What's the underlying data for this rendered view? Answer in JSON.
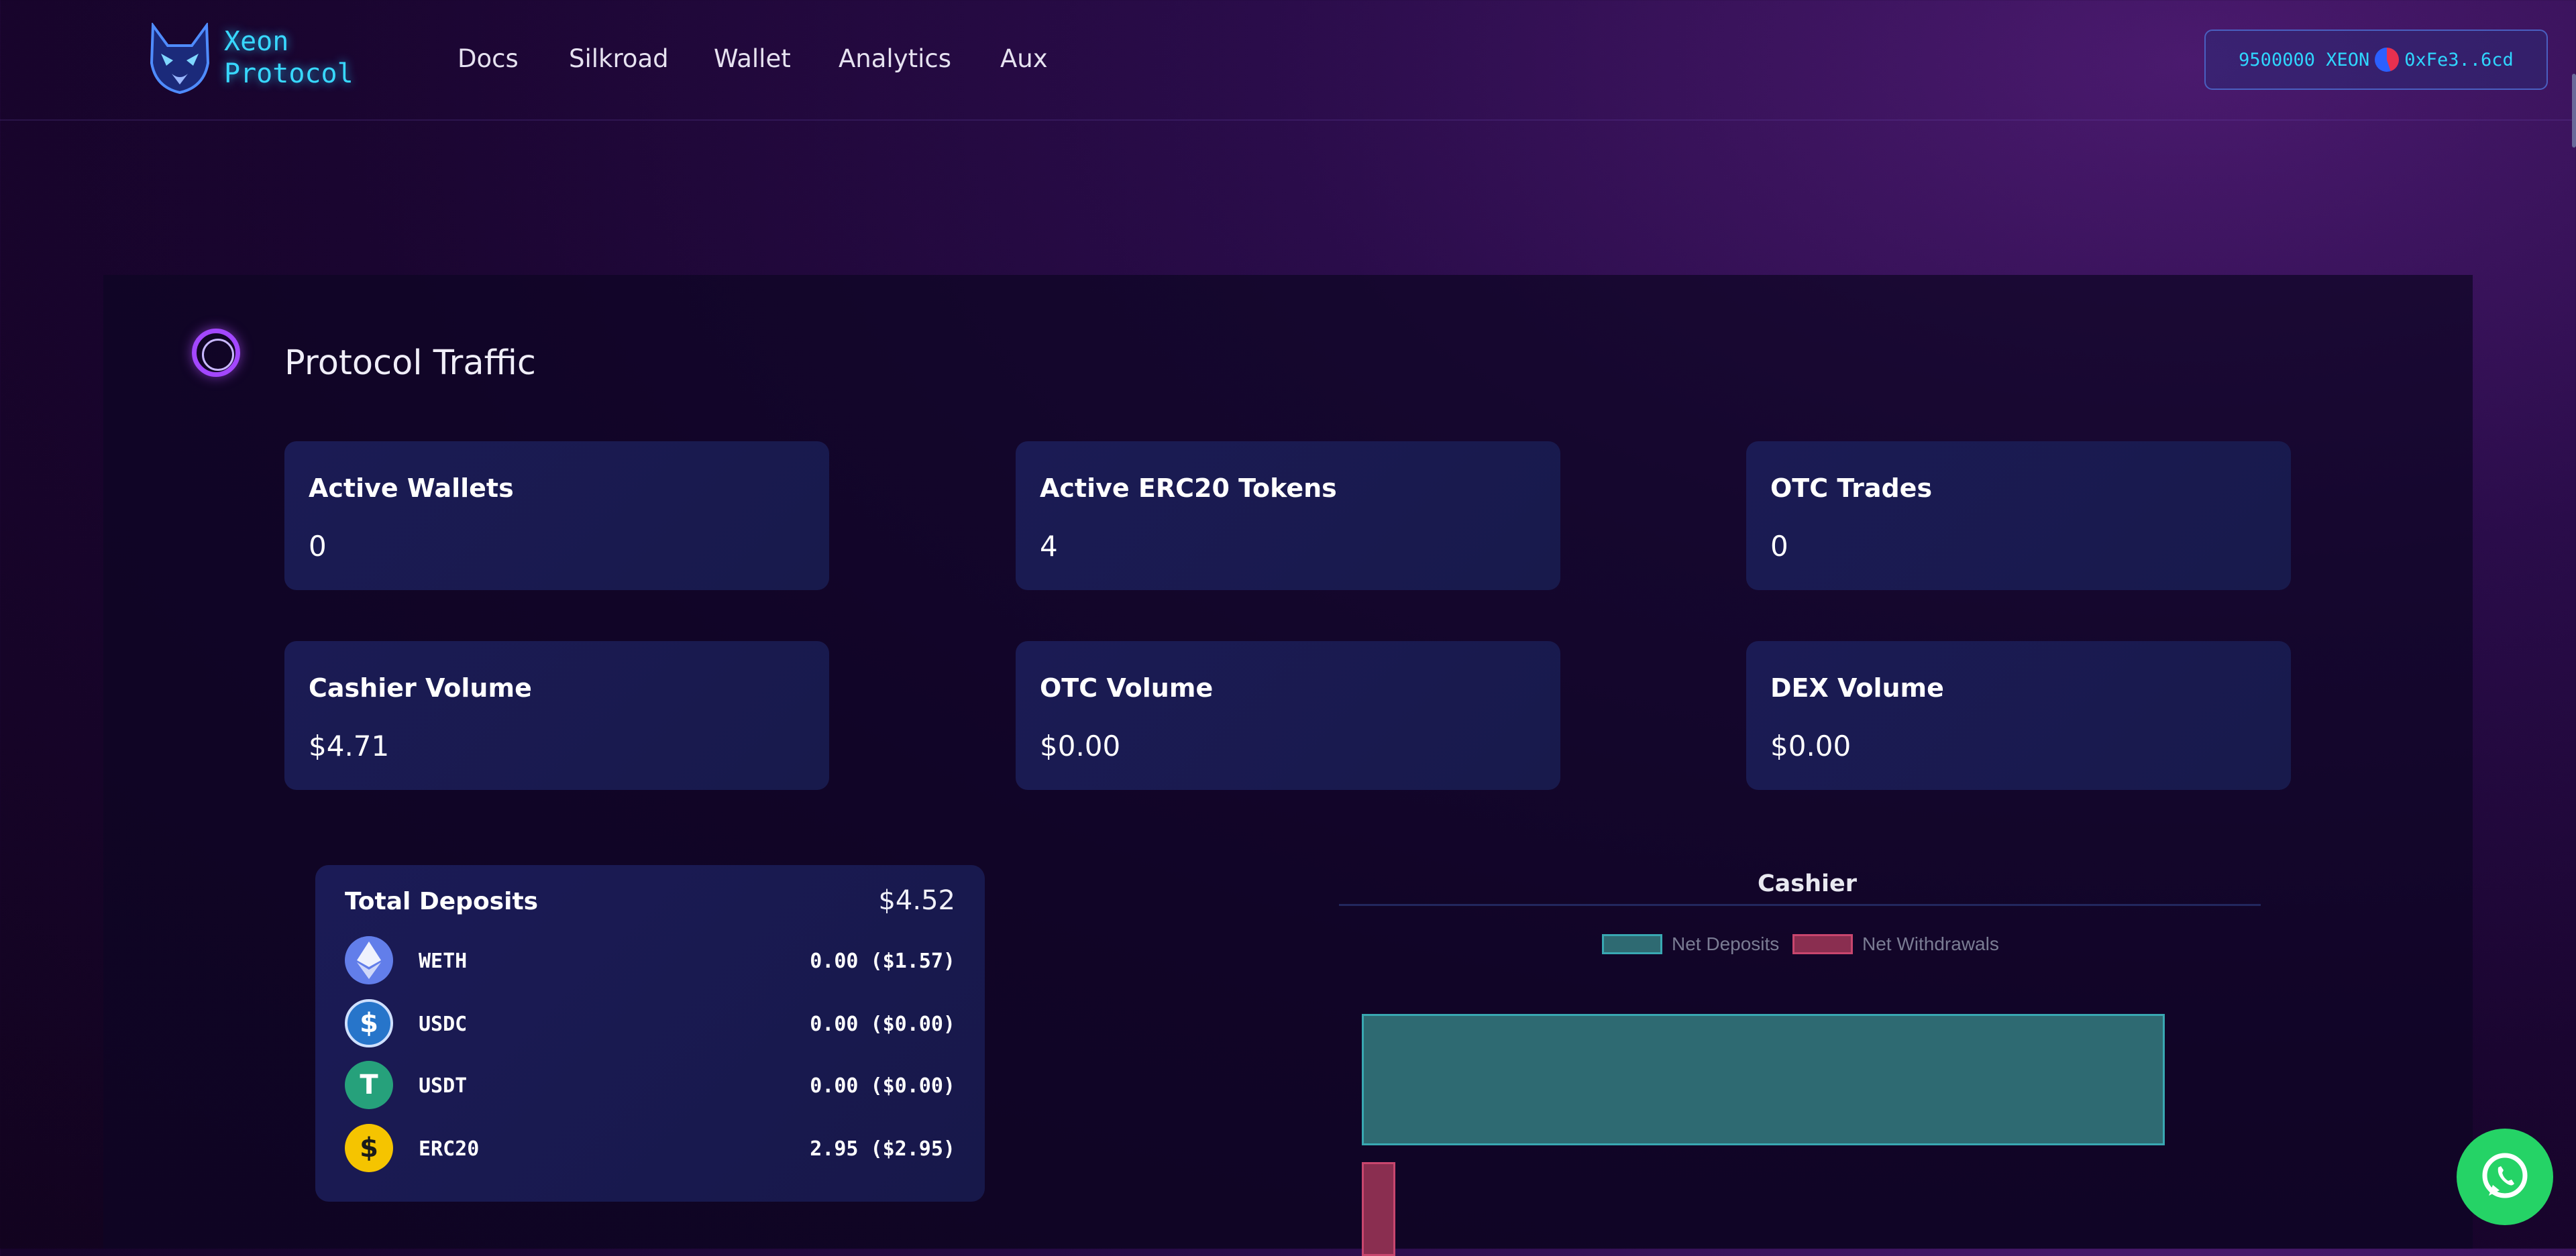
{
  "brand": {
    "line1": "Xeon",
    "line2": "Protocol"
  },
  "nav": [
    "Docs",
    "Silkroad",
    "Wallet",
    "Analytics",
    "Aux"
  ],
  "wallet": {
    "balance": "9500000 XEON",
    "address": "0xFe3..6cd"
  },
  "section_title": "Protocol Traffic",
  "stats": [
    {
      "label": "Active Wallets",
      "value": "0"
    },
    {
      "label": "Active ERC20 Tokens",
      "value": "4"
    },
    {
      "label": "OTC Trades",
      "value": "0"
    },
    {
      "label": "Cashier Volume",
      "value": "$4.71"
    },
    {
      "label": "OTC Volume",
      "value": "$0.00"
    },
    {
      "label": "DEX Volume",
      "value": "$0.00"
    }
  ],
  "deposits": {
    "title": "Total Deposits",
    "total": "$4.52",
    "rows": [
      {
        "symbol": "WETH",
        "amount": "0.00 ($1.57)",
        "icon": "ethereum-icon",
        "color": "#627eea"
      },
      {
        "symbol": "USDC",
        "amount": "0.00 ($0.00)",
        "icon": "usdc-icon",
        "color": "#2775ca"
      },
      {
        "symbol": "USDT",
        "amount": "0.00 ($0.00)",
        "icon": "tether-icon",
        "color": "#26a17b"
      },
      {
        "symbol": "ERC20",
        "amount": "2.95 ($2.95)",
        "icon": "dollar-coin-icon",
        "color": "#f5c400"
      }
    ]
  },
  "chart_data": {
    "type": "bar",
    "title": "Cashier",
    "orientation": "horizontal",
    "grid": false,
    "legend": "top-center",
    "series": [
      {
        "name": "Net Deposits",
        "values": [
          4.52
        ],
        "color": "#2e6a72"
      },
      {
        "name": "Net Withdrawals",
        "values": [
          0.19
        ],
        "color": "#8a2e50"
      }
    ]
  },
  "colors": {
    "accent": "#38d8ff",
    "brand_purple": "#a347ff",
    "card_bg": "#1b1b54",
    "whatsapp": "#25d366"
  }
}
